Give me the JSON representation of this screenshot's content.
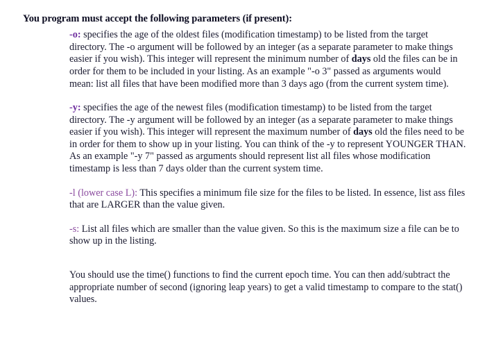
{
  "document": {
    "heading": "You program must accept the following parameters (if present):",
    "paragraphs": [
      {
        "id": "param-oldest",
        "marker": "-o:",
        "marker_style": "strong",
        "marker_color": "#6f2f9f",
        "text_before_emph": " specifies the age of the oldest files (modification timestamp) to be listed from the target directory. The -o argument will be followed by an integer (as a separate parameter to make things easier if you wish). This integer will represent the minimum number of ",
        "emph": "days",
        "text_after_emph": " old the files can be in order for them to be included in your listing. As an example  \"-o 3\" passed as arguments would mean: list all files that have been modified more than 3 days ago (from the current system time)."
      },
      {
        "id": "param-newest",
        "marker": "-y:",
        "marker_style": "strong",
        "marker_color": "#6f2f9f",
        "text_before_emph": " specifies the age of the newest files (modification timestamp) to be listed from the target directory. The -y argument will be followed by an integer (as a separate parameter to make things easier if you wish). This integer will represent the maximum number of ",
        "emph": "days",
        "text_after_emph": " old the files need to be in order for them to show up in your listing. You can think of the -y to represent YOUNGER THAN. As an example \"-y 7\" passed as arguments should represent list all files whose modification timestamp is less than 7 days older than the current system time."
      },
      {
        "id": "param-minsize",
        "marker": "-l (lower case L):",
        "marker_style": "plain",
        "marker_color": "#8a4a9e",
        "text_before_emph": " This specifies a minimum file size for the files to be listed. In essence, list ass files that are LARGER than the value given.",
        "emph": "",
        "text_after_emph": ""
      },
      {
        "id": "param-maxsize",
        "marker": "-s:",
        "marker_style": "plain",
        "marker_color": "#8a4a9e",
        "text_before_emph": " List all files which are smaller than the value given. So this is the maximum size a file can be to show up in the listing.",
        "emph": "",
        "text_after_emph": ""
      }
    ],
    "closing_paragraph": "You should use the time() functions to find the current epoch time. You can then add/subtract the appropriate number of second (ignoring leap years) to get a valid timestamp to compare to the stat() values."
  }
}
